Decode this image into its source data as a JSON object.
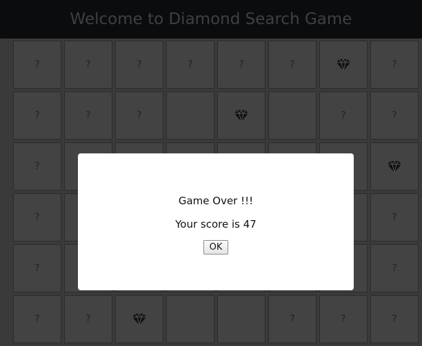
{
  "header": {
    "title": "Welcome to Diamond Search Game"
  },
  "board": {
    "rows": [
      [
        "?",
        "?",
        "?",
        "?",
        "?",
        "?",
        "diamond",
        "?"
      ],
      [
        "?",
        "?",
        "?",
        "",
        "diamond",
        "",
        "?",
        "?"
      ],
      [
        "?",
        "",
        "",
        "",
        "",
        "",
        "",
        "diamond"
      ],
      [
        "?",
        "",
        "",
        "",
        "",
        "",
        "",
        "?"
      ],
      [
        "?",
        "",
        "",
        "",
        "",
        "",
        "",
        "?"
      ],
      [
        "?",
        "?",
        "diamond",
        "",
        "",
        "?",
        "?",
        "?"
      ]
    ]
  },
  "dialog": {
    "title": "Game Over !!!",
    "score_text": "Your score is 47",
    "ok_label": "OK"
  },
  "colors": {
    "header_bg": "#0b0c0e",
    "cell_bg": "#434343",
    "dialog_bg": "#ffffff"
  }
}
